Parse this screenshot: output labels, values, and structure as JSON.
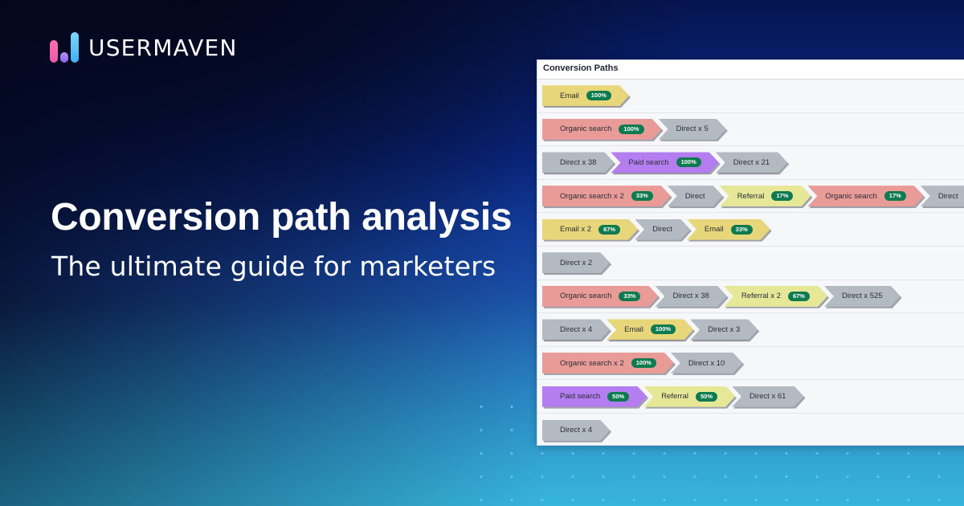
{
  "brand": {
    "name": "USERMAVEN",
    "logo_icon": "bar-chart-logo-icon",
    "colors": {
      "pink": "#ff6fb3",
      "purple": "#9a6ff0",
      "cyan": "#5ec8f5"
    }
  },
  "hero": {
    "title": "Conversion path analysis",
    "subtitle": "The ultimate guide for marketers"
  },
  "panel": {
    "title": "Conversion Paths",
    "channel_colors": {
      "email": "#e8d67a",
      "organic": "#e99b97",
      "direct": "#b4bac2",
      "paid": "#b57ef0",
      "referral": "#e6e898",
      "badge": "#0e7a4f"
    },
    "paths": [
      {
        "steps": [
          {
            "type": "email",
            "label": "Email",
            "pct": "100%"
          }
        ]
      },
      {
        "steps": [
          {
            "type": "organic",
            "label": "Organic search",
            "pct": "100%"
          },
          {
            "type": "direct",
            "label": "Direct x 5"
          }
        ]
      },
      {
        "steps": [
          {
            "type": "direct",
            "label": "Direct x 38"
          },
          {
            "type": "paid",
            "label": "Paid search",
            "pct": "100%"
          },
          {
            "type": "direct",
            "label": "Direct x 21"
          }
        ]
      },
      {
        "steps": [
          {
            "type": "organic",
            "label": "Organic search x 2",
            "pct": "33%"
          },
          {
            "type": "direct",
            "label": "Direct"
          },
          {
            "type": "referral",
            "label": "Referral",
            "pct": "17%"
          },
          {
            "type": "organic",
            "label": "Organic search",
            "pct": "17%"
          },
          {
            "type": "direct",
            "label": "Direct"
          }
        ]
      },
      {
        "steps": [
          {
            "type": "email",
            "label": "Email x 2",
            "pct": "67%"
          },
          {
            "type": "direct",
            "label": "Direct"
          },
          {
            "type": "email",
            "label": "Email",
            "pct": "33%"
          }
        ]
      },
      {
        "steps": [
          {
            "type": "direct",
            "label": "Direct x 2"
          }
        ]
      },
      {
        "steps": [
          {
            "type": "organic",
            "label": "Organic search",
            "pct": "33%"
          },
          {
            "type": "direct",
            "label": "Direct x 38"
          },
          {
            "type": "referral",
            "label": "Referral x 2",
            "pct": "67%"
          },
          {
            "type": "direct",
            "label": "Direct x 525"
          }
        ]
      },
      {
        "steps": [
          {
            "type": "direct",
            "label": "Direct x 4"
          },
          {
            "type": "email",
            "label": "Email",
            "pct": "100%"
          },
          {
            "type": "direct",
            "label": "Direct x 3"
          }
        ]
      },
      {
        "steps": [
          {
            "type": "organic",
            "label": "Organic search x 2",
            "pct": "100%"
          },
          {
            "type": "direct",
            "label": "Direct x 10"
          }
        ]
      },
      {
        "steps": [
          {
            "type": "paid",
            "label": "Paid search",
            "pct": "50%"
          },
          {
            "type": "referral",
            "label": "Referral",
            "pct": "50%"
          },
          {
            "type": "direct",
            "label": "Direct x 61"
          }
        ]
      },
      {
        "steps": [
          {
            "type": "direct",
            "label": "Direct x 4"
          }
        ]
      }
    ]
  }
}
